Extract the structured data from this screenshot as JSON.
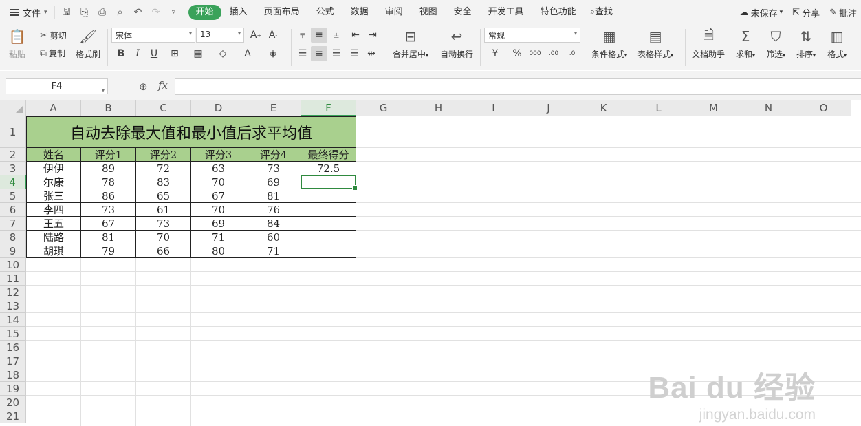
{
  "menubar": {
    "file_label": "文件",
    "tabs": [
      "开始",
      "插入",
      "页面布局",
      "公式",
      "数据",
      "审阅",
      "视图",
      "安全",
      "开发工具",
      "特色功能"
    ],
    "search_label": "查找",
    "unsaved_label": "未保存",
    "share_label": "分享",
    "annotate_label": "批注"
  },
  "ribbon": {
    "paste": "粘贴",
    "cut": "剪切",
    "copy": "复制",
    "format_painter": "格式刷",
    "font_name": "宋体",
    "font_size": "13",
    "merge_center": "合并居中",
    "auto_wrap": "自动换行",
    "number_format": "常规",
    "conditional_format": "条件格式",
    "table_style": "表格样式",
    "doc_assistant": "文档助手",
    "sum": "求和",
    "filter": "筛选",
    "sort": "排序",
    "format": "格式"
  },
  "formula_bar": {
    "name_box": "F4",
    "fx": "fx",
    "formula": ""
  },
  "columns": [
    "A",
    "B",
    "C",
    "D",
    "E",
    "F",
    "G",
    "H",
    "I",
    "J",
    "K",
    "L",
    "M",
    "N",
    "O"
  ],
  "rows": [
    "1",
    "2",
    "3",
    "4",
    "5",
    "6",
    "7",
    "8",
    "9",
    "10",
    "11",
    "12",
    "13",
    "14",
    "15",
    "16",
    "17",
    "18",
    "19",
    "20",
    "21"
  ],
  "sheet": {
    "title": "自动去除最大值和最小值后求平均值",
    "headers": [
      "姓名",
      "评分1",
      "评分2",
      "评分3",
      "评分4",
      "最终得分"
    ],
    "data": [
      [
        "伊伊",
        "89",
        "72",
        "63",
        "73",
        "72.5"
      ],
      [
        "尔康",
        "78",
        "83",
        "70",
        "69",
        ""
      ],
      [
        "张三",
        "86",
        "65",
        "67",
        "81",
        ""
      ],
      [
        "李四",
        "73",
        "61",
        "70",
        "76",
        ""
      ],
      [
        "王五",
        "67",
        "73",
        "69",
        "84",
        ""
      ],
      [
        "陆路",
        "81",
        "70",
        "71",
        "60",
        ""
      ],
      [
        "胡琪",
        "79",
        "66",
        "80",
        "71",
        ""
      ]
    ]
  },
  "watermark": {
    "main": "Bai du 经验",
    "sub": "jingyan.baidu.com"
  }
}
